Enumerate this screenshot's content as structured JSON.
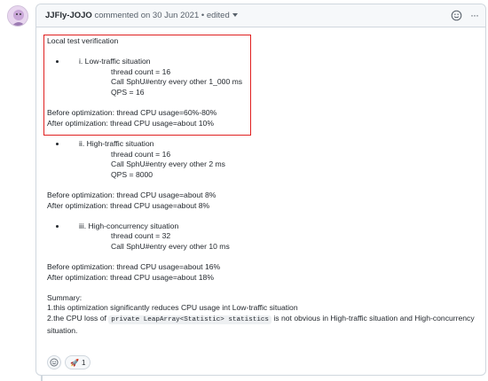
{
  "header": {
    "author": "JJFly-JOJO",
    "meta": "commented on 30 Jun 2021",
    "edited": "• edited",
    "icons": [
      "smiley-icon",
      "kebab-icon",
      "chevron-down-icon"
    ]
  },
  "body": {
    "title": "Local test verification",
    "low": {
      "label": "i. Low-traffic situation",
      "lines": [
        "thread count = 16",
        "Call SphU#entry every other 1_000 ms",
        "QPS = 16"
      ],
      "before": "Before optimization: thread CPU usage=60%-80%",
      "after": "After optimization: thread CPU usage=about 10%"
    },
    "high": {
      "label": "ii. High-traffic situation",
      "lines": [
        "thread count = 16",
        "Call SphU#entry every other 2 ms",
        "QPS = 8000"
      ],
      "before": "Before optimization: thread CPU usage=about 8%",
      "after": "After optimization: thread CPU usage=about 8%"
    },
    "concurrency": {
      "label": "iii. High-concurrency situation",
      "lines": [
        "thread count = 32",
        "Call SphU#entry every other 10 ms"
      ],
      "before": "Before optimization: thread CPU usage=about 16%",
      "after": "After optimization: thread CPU usage=about 18%"
    },
    "summary": {
      "title": "Summary:",
      "line1": "1.this optimization significantly reduces CPU usage int Low-traffic situation",
      "line2_pre": "2.the CPU loss of",
      "code": "private LeapArray<Statistic> statistics",
      "line2_post": "is not obvious in High-traffic situation and High-concurrency situation."
    }
  },
  "reactions": {
    "rocket_emoji": "🚀",
    "rocket_count": "1"
  },
  "colors": {
    "highlight": "#e02020",
    "border": "#d0d7de",
    "header_bg": "#f6f8fa"
  }
}
